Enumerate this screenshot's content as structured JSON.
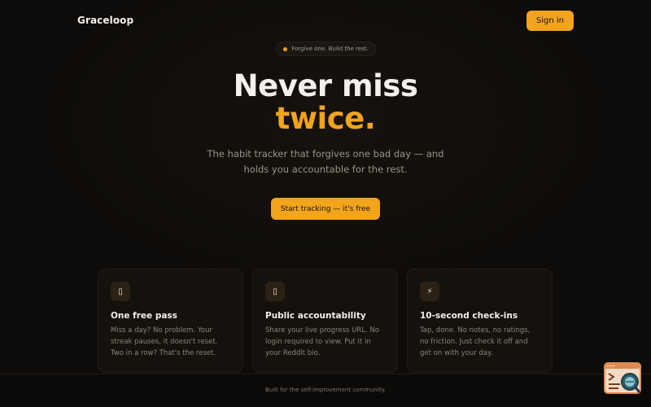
{
  "nav": {
    "brand": "Graceloop",
    "sign_in_label": "Sign in"
  },
  "hero": {
    "badge_text": "Forgive one. Build the rest.",
    "headline_line1": "Never miss",
    "headline_line2": "twice.",
    "subtitle_line1": "The habit tracker that forgives one bad day — and",
    "subtitle_line2": "holds you accountable for the rest.",
    "cta_label": "Start tracking — it's free"
  },
  "features": [
    {
      "icon": "square-glyph-icon",
      "icon_glyph": "▯",
      "title": "One free pass",
      "description": "Miss a day? No problem. Your streak pauses, it doesn't reset. Two in a row? That's the reset."
    },
    {
      "icon": "square-glyph-icon",
      "icon_glyph": "▯",
      "title": "Public accountability",
      "description": "Share your live progress URL. No login required to view. Put it in your Reddit bio."
    },
    {
      "icon": "lightning-icon",
      "icon_glyph": "⚡",
      "title": "10-second check-ins",
      "description": "Tap, done. No notes, no ratings, no friction. Just check it off and get on with your day."
    }
  ],
  "footer": {
    "text": "Built for the self-improvement community."
  },
  "colors": {
    "accent": "#f2a41c",
    "background": "#0e0c0a",
    "card": "#15120e"
  }
}
